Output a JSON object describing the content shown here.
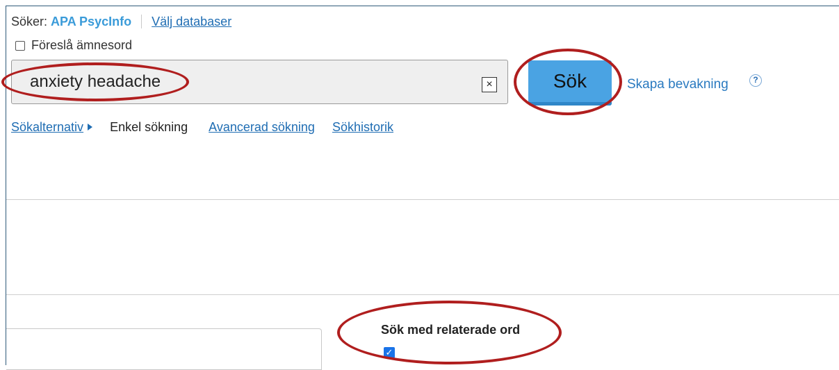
{
  "header": {
    "searching_label": "Söker:",
    "database_name": "APA PsycInfo",
    "choose_db_link": "Välj databaser"
  },
  "suggest_subject": {
    "label": "Föreslå ämnesord",
    "checked": false
  },
  "search": {
    "query": "anxiety headache",
    "clear_symbol": "×",
    "button_label": "Sök",
    "alert_link": "Skapa bevakning",
    "help_symbol": "?"
  },
  "nav": {
    "options_link": "Sökalternativ",
    "basic_search": "Enkel sökning",
    "advanced_link": "Avancerad sökning",
    "history_link": "Sökhistorik"
  },
  "options": {
    "related_words_label": "Sök med relaterade ord",
    "related_words_checked": true,
    "check_symbol": "✓"
  },
  "colors": {
    "accent": "#4aa3e3",
    "link": "#1f6db3",
    "annotation": "#b01e1e"
  }
}
